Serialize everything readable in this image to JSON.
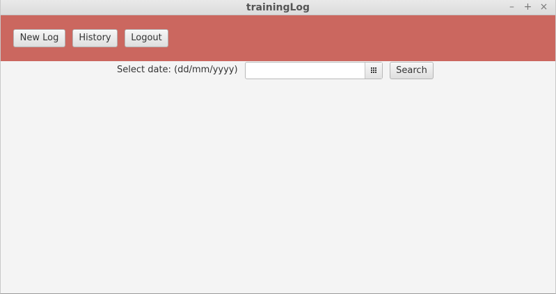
{
  "window": {
    "title": "trainingLog",
    "controls": {
      "minimize": "–",
      "maximize": "+",
      "close": "×"
    }
  },
  "toolbar": {
    "background": "#cb675f",
    "new_log_label": "New Log",
    "history_label": "History",
    "logout_label": "Logout"
  },
  "search": {
    "date_label": "Select date: (dd/mm/yyyy)",
    "date_value": "",
    "calendar_icon": "calendar-icon",
    "search_label": "Search"
  }
}
